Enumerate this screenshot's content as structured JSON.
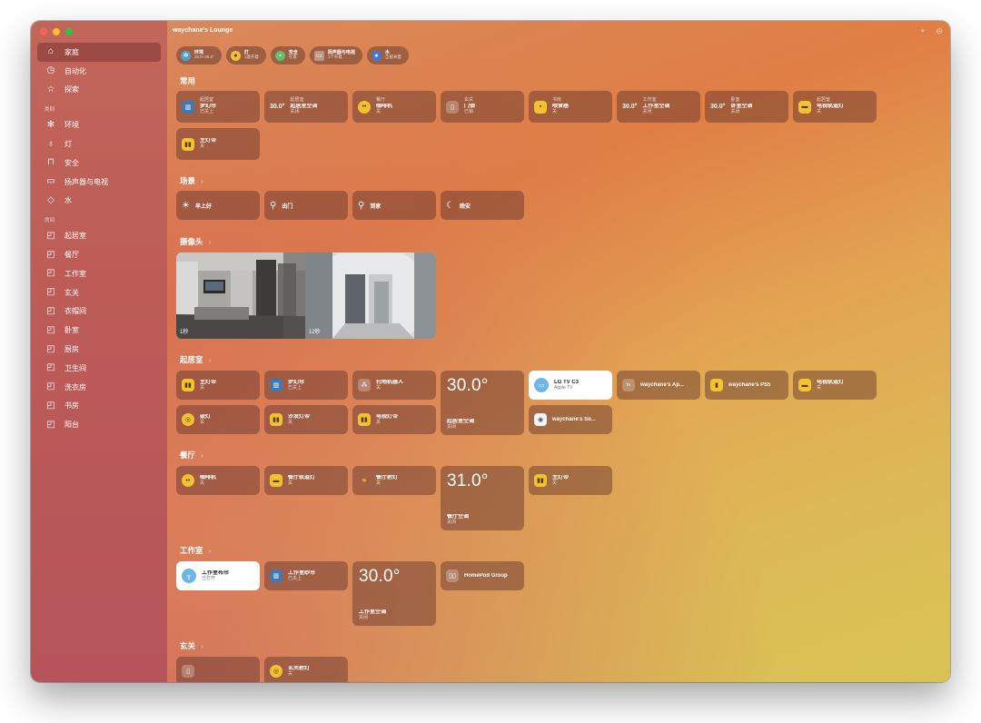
{
  "window": {
    "title": "waychane's Lounge"
  },
  "sidebar": {
    "top_items": [
      {
        "label": "家庭",
        "icon": "house-icon"
      },
      {
        "label": "自动化",
        "icon": "clock-icon"
      },
      {
        "label": "探索",
        "icon": "star-icon"
      }
    ],
    "category_header": "类别",
    "categories": [
      {
        "label": "环境",
        "icon": "fan-icon"
      },
      {
        "label": "灯",
        "icon": "lightbulb-icon"
      },
      {
        "label": "安全",
        "icon": "lock-icon"
      },
      {
        "label": "扬声器与电视",
        "icon": "tv-speaker-icon"
      },
      {
        "label": "水",
        "icon": "drop-icon"
      }
    ],
    "room_header": "房间",
    "rooms": [
      "起居室",
      "餐厅",
      "工作室",
      "玄关",
      "衣帽间",
      "卧室",
      "厨房",
      "卫生间",
      "洗衣房",
      "书房",
      "阳台"
    ]
  },
  "status_pills": [
    {
      "title": "环境",
      "sub": "26.0–35.5°"
    },
    {
      "title": "灯",
      "sub": "1盏开着"
    },
    {
      "title": "安全",
      "sub": "在家"
    },
    {
      "title": "扬声器与电视",
      "sub": "1个开着"
    },
    {
      "title": "水",
      "sub": "全部关着"
    }
  ],
  "sections": {
    "favorites": "常用",
    "scenes": "场景",
    "cameras": "摄像头",
    "living": "起居室",
    "dining": "餐厅",
    "studio": "工作室",
    "entry": "玄关"
  },
  "favorites": [
    {
      "room": "起居室",
      "name": "梦幻帘",
      "status": "已关上"
    },
    {
      "temp": "30.0°",
      "room": "起居室",
      "name": "起居室空调",
      "status": "关闭"
    },
    {
      "room": "餐厅",
      "name": "咖啡机",
      "status": "关"
    },
    {
      "room": "玄关",
      "name": "门锁",
      "status": "已锁"
    },
    {
      "room": "书房",
      "name": "喂食器",
      "status": "关"
    },
    {
      "temp": "30.0°",
      "room": "工作室",
      "name": "工作室空调",
      "status": "关闭"
    },
    {
      "temp": "30.0°",
      "room": "卧室",
      "name": "卧室空调",
      "status": "关闭"
    },
    {
      "room": "起居室",
      "name": "电视轨道灯",
      "status": "关"
    },
    {
      "name": "主灯带",
      "status": "关"
    }
  ],
  "scenes": [
    {
      "name": "早上好"
    },
    {
      "name": "出门"
    },
    {
      "name": "到家"
    },
    {
      "name": "晚安"
    }
  ],
  "cameras": [
    {
      "label": "1秒"
    },
    {
      "label": "12秒"
    }
  ],
  "living": {
    "lights_main": {
      "name": "主灯带",
      "status": "关"
    },
    "curtain": {
      "name": "梦幻帘",
      "status": "已关上"
    },
    "robot": {
      "name": "扫地机器人",
      "status": "关"
    },
    "ac": {
      "temp": "30.0°",
      "name": "起居室空调",
      "status": "关闭"
    },
    "tv": {
      "name": "LG TV C3",
      "status": "Apple TV"
    },
    "appletv": {
      "name": "waychane's Ap..."
    },
    "ps5": {
      "name": "waychane's PS5"
    },
    "track": {
      "name": "电视轨道灯",
      "status": "关"
    },
    "ceiling": {
      "name": "嵌灯",
      "status": "关"
    },
    "sofa": {
      "name": "沙发灯带",
      "status": "关"
    },
    "tvlight": {
      "name": "电视灯带",
      "status": "关"
    },
    "sonos": {
      "name": "waychane's So..."
    }
  },
  "dining": {
    "coffee": {
      "name": "咖啡机",
      "status": "关"
    },
    "track": {
      "name": "餐厅轨道灯",
      "status": "关"
    },
    "spot": {
      "name": "餐厅射灯",
      "status": "关"
    },
    "ac": {
      "temp": "31.0°",
      "name": "餐厅空调",
      "status": "关闭"
    },
    "main": {
      "name": "主灯带",
      "status": "关"
    }
  },
  "studio": {
    "curtain1": {
      "name": "工作室布帘",
      "status": "已打开"
    },
    "curtain2": {
      "name": "工作室纱帘",
      "status": "已关上"
    },
    "ac": {
      "temp": "30.0°",
      "name": "工作室空调",
      "status": "关闭"
    },
    "homepod": {
      "name": "HomePod Group"
    }
  },
  "entry": {
    "spot": {
      "name": "玄关射灯",
      "status": "关"
    }
  },
  "colors": {
    "sidebar": "#bd5c57",
    "main_top": "#e07e45",
    "main_bottom": "#d9c354",
    "tile": "#643728"
  }
}
